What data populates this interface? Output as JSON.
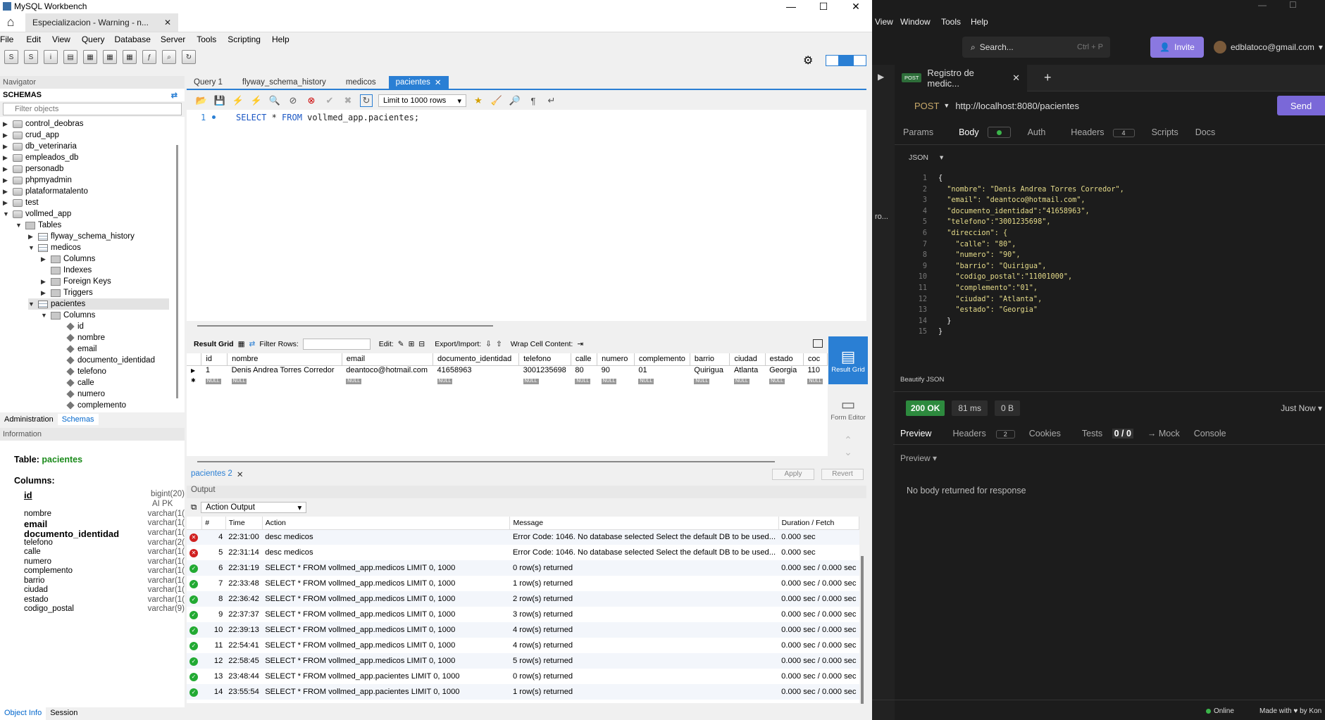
{
  "workbench": {
    "app_title": "MySQL Workbench",
    "connection_tab": "Especializacion - Warning - n...",
    "menu": [
      "File",
      "Edit",
      "View",
      "Query",
      "Database",
      "Server",
      "Tools",
      "Scripting",
      "Help"
    ],
    "navigator_label": "Navigator",
    "schemas_label": "SCHEMAS",
    "filter_placeholder": "Filter objects",
    "schemas": [
      "control_deobras",
      "crud_app",
      "db_veterinaria",
      "empleados_db",
      "personadb",
      "phpmyadmin",
      "plataformatalento",
      "test",
      "vollmed_app"
    ],
    "tables_label": "Tables",
    "tables": [
      "flyway_schema_history",
      "medicos",
      "pacientes"
    ],
    "medicos_children": [
      "Columns",
      "Indexes",
      "Foreign Keys",
      "Triggers"
    ],
    "columns_label": "Columns",
    "pacientes_columns": [
      "id",
      "nombre",
      "email",
      "documento_identidad",
      "telefono",
      "calle",
      "numero",
      "complemento"
    ],
    "nav_tabs": [
      "Administration",
      "Schemas"
    ],
    "information_label": "Information",
    "info_table_label": "Table:",
    "info_table_name": "pacientes",
    "info_columns_label": "Columns:",
    "info_columns": [
      {
        "name": "id",
        "type": "bigint(20)"
      },
      {
        "name": "",
        "type": "AI PK"
      },
      {
        "name": "nombre",
        "type": "varchar(1("
      },
      {
        "name": "email",
        "type": "varchar(1("
      },
      {
        "name": "documento_identidad",
        "type": "varchar(1("
      },
      {
        "name": "telefono",
        "type": "varchar(2("
      },
      {
        "name": "calle",
        "type": "varchar(1("
      },
      {
        "name": "numero",
        "type": "varchar(1("
      },
      {
        "name": "complemento",
        "type": "varchar(1("
      },
      {
        "name": "barrio",
        "type": "varchar(1("
      },
      {
        "name": "ciudad",
        "type": "varchar(1("
      },
      {
        "name": "estado",
        "type": "varchar(1("
      },
      {
        "name": "codigo_postal",
        "type": "varchar(9)"
      }
    ],
    "bottom_tabs": [
      "Object Info",
      "Session"
    ],
    "editor_tabs": [
      "Query 1",
      "flyway_schema_history",
      "medicos",
      "pacientes"
    ],
    "limit_label": "Limit to 1000 rows",
    "sql_line": "1",
    "sql_keyword1": "SELECT",
    "sql_star": " * ",
    "sql_keyword2": "FROM",
    "sql_rest": " vollmed_app.pacientes;",
    "rg": {
      "result_grid": "Result Grid",
      "filter_rows": "Filter Rows:",
      "edit": "Edit:",
      "export": "Export/Import:",
      "wrap": "Wrap Cell Content:"
    },
    "grid_columns": [
      "id",
      "nombre",
      "email",
      "documento_identidad",
      "telefono",
      "calle",
      "numero",
      "complemento",
      "barrio",
      "ciudad",
      "estado",
      "coc"
    ],
    "grid_row": [
      "1",
      "Denis Andrea Torres Corredor",
      "deantoco@hotmail.com",
      "41658963",
      "3001235698",
      "80",
      "90",
      "01",
      "Quirigua",
      "Atlanta",
      "Georgia",
      "110"
    ],
    "null_label": "NULL",
    "side_tabs": [
      "Result Grid",
      "Form Editor"
    ],
    "result_tab": "pacientes 2",
    "apply": "Apply",
    "revert": "Revert",
    "output_label": "Output",
    "action_output": "Action Output",
    "out_columns": [
      "#",
      "Time",
      "Action",
      "Message",
      "Duration / Fetch"
    ],
    "out_rows": [
      {
        "status": "error",
        "n": "4",
        "time": "22:31:00",
        "action": "desc medicos",
        "msg": "Error Code: 1046. No database selected Select the default DB to be used...",
        "dur": "0.000 sec"
      },
      {
        "status": "error",
        "n": "5",
        "time": "22:31:14",
        "action": "desc medicos",
        "msg": "Error Code: 1046. No database selected Select the default DB to be used...",
        "dur": "0.000 sec"
      },
      {
        "status": "ok",
        "n": "6",
        "time": "22:31:19",
        "action": "SELECT * FROM vollmed_app.medicos LIMIT 0, 1000",
        "msg": "0 row(s) returned",
        "dur": "0.000 sec / 0.000 sec"
      },
      {
        "status": "ok",
        "n": "7",
        "time": "22:33:48",
        "action": "SELECT * FROM vollmed_app.medicos LIMIT 0, 1000",
        "msg": "1 row(s) returned",
        "dur": "0.000 sec / 0.000 sec"
      },
      {
        "status": "ok",
        "n": "8",
        "time": "22:36:42",
        "action": "SELECT * FROM vollmed_app.medicos LIMIT 0, 1000",
        "msg": "2 row(s) returned",
        "dur": "0.000 sec / 0.000 sec"
      },
      {
        "status": "ok",
        "n": "9",
        "time": "22:37:37",
        "action": "SELECT * FROM vollmed_app.medicos LIMIT 0, 1000",
        "msg": "3 row(s) returned",
        "dur": "0.000 sec / 0.000 sec"
      },
      {
        "status": "ok",
        "n": "10",
        "time": "22:39:13",
        "action": "SELECT * FROM vollmed_app.medicos LIMIT 0, 1000",
        "msg": "4 row(s) returned",
        "dur": "0.000 sec / 0.000 sec"
      },
      {
        "status": "ok",
        "n": "11",
        "time": "22:54:41",
        "action": "SELECT * FROM vollmed_app.medicos LIMIT 0, 1000",
        "msg": "4 row(s) returned",
        "dur": "0.000 sec / 0.000 sec"
      },
      {
        "status": "ok",
        "n": "12",
        "time": "22:58:45",
        "action": "SELECT * FROM vollmed_app.medicos LIMIT 0, 1000",
        "msg": "5 row(s) returned",
        "dur": "0.000 sec / 0.000 sec"
      },
      {
        "status": "ok",
        "n": "13",
        "time": "23:48:44",
        "action": "SELECT * FROM vollmed_app.pacientes LIMIT 0, 1000",
        "msg": "0 row(s) returned",
        "dur": "0.000 sec / 0.000 sec"
      },
      {
        "status": "ok",
        "n": "14",
        "time": "23:55:54",
        "action": "SELECT * FROM vollmed_app.pacientes LIMIT 0, 1000",
        "msg": "1 row(s) returned",
        "dur": "0.000 sec / 0.000 sec"
      }
    ]
  },
  "insomnia": {
    "menu": [
      "View",
      "Window",
      "Tools",
      "Help"
    ],
    "search": "Search...",
    "search_shortcut": "Ctrl + P",
    "invite": "Invite",
    "user": "edblatoco@gmail.com",
    "method_badge": "POST",
    "request_name": "Registro de medic...",
    "method": "POST",
    "url": "http://localhost:8080/pacientes",
    "send": "Send",
    "req_tabs": {
      "params": "Params",
      "body": "Body",
      "auth": "Auth",
      "headers": "Headers",
      "headers_count": "4",
      "scripts": "Scripts",
      "docs": "Docs"
    },
    "body_type": "JSON",
    "body_lines": [
      "{",
      "  \"nombre\": \"Denis Andrea Torres Corredor\",",
      "  \"email\": \"deantoco@hotmail.com\",",
      "  \"documento_identidad\":\"41658963\",",
      "  \"telefono\":\"3001235698\",",
      "  \"direccion\": {",
      "    \"calle\": \"80\",",
      "    \"numero\": \"90\",",
      "    \"barrio\": \"Quirigua\",",
      "    \"codigo_postal\":\"11001000\",",
      "    \"complemento\":\"01\",",
      "    \"ciudad\": \"Atlanta\",",
      "    \"estado\": \"Georgia\"",
      "  }",
      "}"
    ],
    "beautify": "Beautify JSON",
    "status": "200 OK",
    "time": "81 ms",
    "size": "0 B",
    "when": "Just Now",
    "resp_tabs": {
      "preview": "Preview",
      "headers": "Headers",
      "headers_count": "2",
      "cookies": "Cookies",
      "tests": "Tests",
      "tests_count": "0 / 0",
      "mock": "→ Mock",
      "console": "Console"
    },
    "preview_sel": "Preview",
    "no_body": "No body returned for response",
    "online": "Online",
    "made_with": "Made with ♥ by Kon"
  }
}
